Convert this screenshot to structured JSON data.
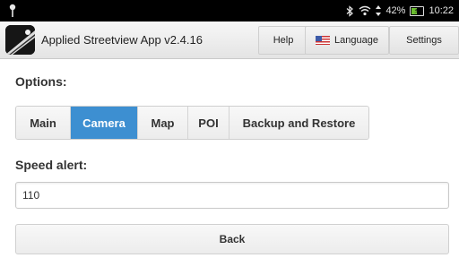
{
  "status_bar": {
    "left_icon": "android-debug-icon",
    "bluetooth_icon": "bluetooth-icon",
    "wifi_icon": "wifi-icon",
    "data_icon": "data-arrows-icon",
    "battery_percent": "42%",
    "battery_level": 0.42,
    "battery_icon": "battery-charging-icon",
    "time": "10:22"
  },
  "header": {
    "app_icon": "streetview-app-icon",
    "title": "Applied Streetview App v2.4.16",
    "help_label": "Help",
    "language_label": "Language",
    "language_flag_icon": "us-flag-icon",
    "settings_label": "Settings"
  },
  "main": {
    "options_label": "Options:",
    "tabs": [
      {
        "label": "Main",
        "active": false
      },
      {
        "label": "Camera",
        "active": true
      },
      {
        "label": "Map",
        "active": false
      },
      {
        "label": "POI",
        "active": false
      },
      {
        "label": "Backup and Restore",
        "active": false
      }
    ],
    "speed_alert_label": "Speed alert:",
    "speed_alert_value": "110",
    "back_label": "Back"
  },
  "colors": {
    "active_tab": "#3d8fd1",
    "status_bar": "#000000",
    "battery_fill": "#6bbe2f"
  }
}
